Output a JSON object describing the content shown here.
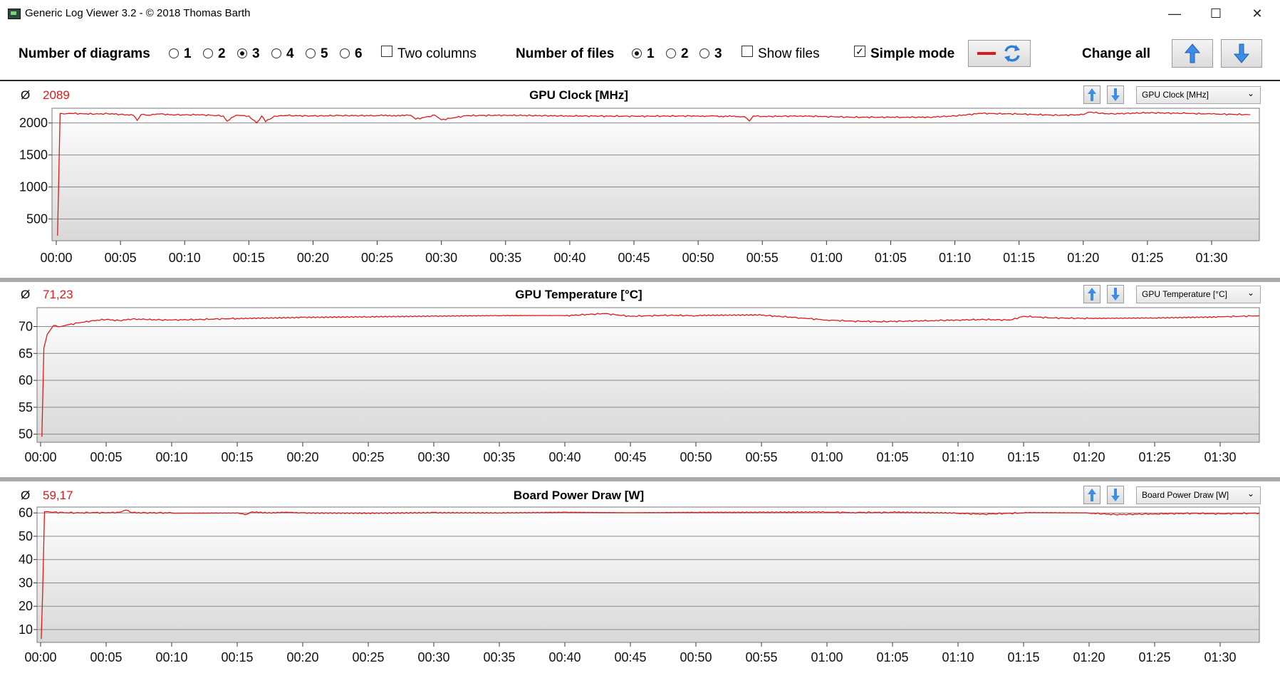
{
  "window": {
    "title": "Generic Log Viewer 3.2 - © 2018 Thomas Barth",
    "minimize_glyph": "—",
    "maximize_glyph": "☐",
    "close_glyph": "✕"
  },
  "toolbar": {
    "num_diagrams_label": "Number of diagrams",
    "diagram_options": [
      "1",
      "2",
      "3",
      "4",
      "5",
      "6"
    ],
    "diagram_selected": "3",
    "two_columns_label": "Two columns",
    "num_files_label": "Number of files",
    "file_options": [
      "1",
      "2",
      "3"
    ],
    "file_selected": "1",
    "show_files_label": "Show files",
    "simple_mode_label": "Simple mode",
    "simple_mode_checked": true,
    "change_all_label": "Change all",
    "icons": {
      "line": "red-line-icon",
      "refresh": "refresh-icon",
      "up": "arrow-up-icon",
      "down": "arrow-down-icon"
    }
  },
  "colors": {
    "series": "#e01818",
    "up_arrow": "#3b8ee8",
    "plot_bg_top": "#ffffff",
    "plot_bg_bottom": "#d8d8d8"
  },
  "panels": [
    {
      "avg_symbol": "Ø",
      "avg_value": "2089",
      "title": "GPU Clock [MHz]",
      "selector_value": "GPU Clock [MHz]"
    },
    {
      "avg_symbol": "Ø",
      "avg_value": "71,23",
      "title": "GPU Temperature [°C]",
      "selector_value": "GPU Temperature [°C]"
    },
    {
      "avg_symbol": "Ø",
      "avg_value": "59,17",
      "title": "Board Power Draw [W]",
      "selector_value": "Board Power Draw [W]"
    }
  ],
  "chart_data": [
    {
      "type": "line",
      "title": "GPU Clock [MHz]",
      "x_unit": "minutes",
      "xlim": [
        0,
        93.2
      ],
      "ylim": [
        160,
        2230
      ],
      "yticks": [
        500,
        1000,
        1500,
        2000
      ],
      "xticks": [
        "00:00",
        "00:05",
        "00:10",
        "00:15",
        "00:20",
        "00:25",
        "00:30",
        "00:35",
        "00:40",
        "00:45",
        "00:50",
        "00:55",
        "01:00",
        "01:05",
        "01:10",
        "01:15",
        "01:20",
        "01:25",
        "01:30"
      ],
      "grid": true,
      "series": [
        {
          "x": [
            0.1,
            0.3,
            0.6,
            1,
            2,
            3,
            4,
            5,
            6,
            6.3,
            6.6,
            7,
            8,
            9,
            10,
            11,
            12,
            13,
            13.3,
            14,
            15,
            15.6,
            16,
            16.3,
            17,
            18,
            20,
            22,
            25,
            27.6,
            28,
            29.5,
            30,
            32,
            35,
            40,
            45,
            50,
            53.6,
            54,
            54.3,
            55,
            58,
            60,
            62,
            64,
            66,
            68,
            70,
            72,
            75,
            78,
            80,
            80.5,
            82,
            85,
            88,
            90,
            93
          ],
          "y": [
            240,
            2150,
            2140,
            2150,
            2145,
            2140,
            2145,
            2135,
            2120,
            2040,
            2130,
            2120,
            2140,
            2130,
            2125,
            2130,
            2120,
            2110,
            2030,
            2120,
            2110,
            2000,
            2110,
            2020,
            2110,
            2115,
            2110,
            2115,
            2115,
            2120,
            2060,
            2120,
            2050,
            2115,
            2120,
            2110,
            2105,
            2110,
            2100,
            2030,
            2110,
            2100,
            2110,
            2100,
            2090,
            2090,
            2090,
            2090,
            2110,
            2150,
            2140,
            2120,
            2130,
            2170,
            2140,
            2160,
            2150,
            2140,
            2130
          ]
        }
      ]
    },
    {
      "type": "line",
      "title": "GPU Temperature [°C]",
      "x_unit": "minutes",
      "xlim": [
        0,
        93.2
      ],
      "ylim": [
        48.5,
        73.5
      ],
      "yticks": [
        50,
        55,
        60,
        65,
        70
      ],
      "xticks": [
        "00:00",
        "00:05",
        "00:10",
        "00:15",
        "00:20",
        "00:25",
        "00:30",
        "00:35",
        "00:40",
        "00:45",
        "00:50",
        "00:55",
        "01:00",
        "01:05",
        "01:10",
        "01:15",
        "01:20",
        "01:25",
        "01:30"
      ],
      "grid": true,
      "series": [
        {
          "x": [
            0.1,
            0.25,
            0.5,
            1,
            1.5,
            2,
            3,
            4,
            5,
            6,
            7,
            8,
            10,
            12,
            15,
            20,
            25,
            30,
            35,
            40,
            43,
            45,
            48,
            50,
            55,
            58,
            60,
            62,
            64,
            66,
            68,
            70,
            72,
            74,
            75,
            77,
            80,
            85,
            90,
            93
          ],
          "y": [
            49.5,
            66,
            68.5,
            70.2,
            70,
            70.3,
            70.7,
            71.1,
            71.3,
            71.1,
            71.4,
            71.3,
            71.2,
            71.3,
            71.5,
            71.7,
            71.8,
            71.9,
            72,
            72,
            72.4,
            71.9,
            72.1,
            72,
            72.1,
            71.6,
            71.2,
            71,
            70.9,
            71,
            71.1,
            71.2,
            71.3,
            71.2,
            71.9,
            71.6,
            71.5,
            71.6,
            71.8,
            72
          ]
        }
      ]
    },
    {
      "type": "line",
      "title": "Board Power Draw [W]",
      "x_unit": "minutes",
      "xlim": [
        0,
        93.2
      ],
      "ylim": [
        4.5,
        62.5
      ],
      "yticks": [
        10,
        20,
        30,
        40,
        50,
        60
      ],
      "xticks": [
        "00:00",
        "00:05",
        "00:10",
        "00:15",
        "00:20",
        "00:25",
        "00:30",
        "00:35",
        "00:40",
        "00:45",
        "00:50",
        "00:55",
        "01:00",
        "01:05",
        "01:10",
        "01:15",
        "01:20",
        "01:25",
        "01:30"
      ],
      "grid": true,
      "series": [
        {
          "x": [
            0.05,
            0.15,
            0.3,
            1,
            2,
            3,
            4,
            5,
            6,
            6.5,
            7,
            10,
            15,
            15.6,
            16,
            20,
            25,
            30,
            35,
            40,
            45,
            50,
            55,
            60,
            62,
            65,
            70,
            72,
            75,
            80,
            82,
            85,
            88,
            90,
            93
          ],
          "y": [
            6,
            25,
            60.5,
            60.3,
            60.1,
            60,
            60.2,
            60,
            60.3,
            61.2,
            60.1,
            60,
            60.1,
            59.2,
            60.2,
            60.1,
            60,
            60.2,
            60.1,
            60.3,
            60.1,
            60.2,
            60.2,
            60.3,
            60.2,
            60.2,
            59.8,
            59.5,
            60,
            59.9,
            59.3,
            59.6,
            59.8,
            59.6,
            59.9
          ]
        }
      ]
    }
  ]
}
